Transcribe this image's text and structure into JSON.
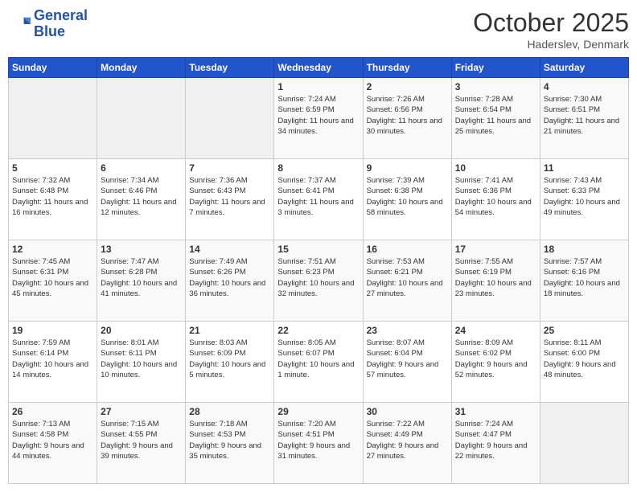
{
  "header": {
    "logo_line1": "General",
    "logo_line2": "Blue",
    "month_title": "October 2025",
    "location": "Haderslev, Denmark"
  },
  "days_of_week": [
    "Sunday",
    "Monday",
    "Tuesday",
    "Wednesday",
    "Thursday",
    "Friday",
    "Saturday"
  ],
  "weeks": [
    [
      {
        "day": "",
        "info": ""
      },
      {
        "day": "",
        "info": ""
      },
      {
        "day": "",
        "info": ""
      },
      {
        "day": "1",
        "info": "Sunrise: 7:24 AM\nSunset: 6:59 PM\nDaylight: 11 hours\nand 34 minutes."
      },
      {
        "day": "2",
        "info": "Sunrise: 7:26 AM\nSunset: 6:56 PM\nDaylight: 11 hours\nand 30 minutes."
      },
      {
        "day": "3",
        "info": "Sunrise: 7:28 AM\nSunset: 6:54 PM\nDaylight: 11 hours\nand 25 minutes."
      },
      {
        "day": "4",
        "info": "Sunrise: 7:30 AM\nSunset: 6:51 PM\nDaylight: 11 hours\nand 21 minutes."
      }
    ],
    [
      {
        "day": "5",
        "info": "Sunrise: 7:32 AM\nSunset: 6:48 PM\nDaylight: 11 hours\nand 16 minutes."
      },
      {
        "day": "6",
        "info": "Sunrise: 7:34 AM\nSunset: 6:46 PM\nDaylight: 11 hours\nand 12 minutes."
      },
      {
        "day": "7",
        "info": "Sunrise: 7:36 AM\nSunset: 6:43 PM\nDaylight: 11 hours\nand 7 minutes."
      },
      {
        "day": "8",
        "info": "Sunrise: 7:37 AM\nSunset: 6:41 PM\nDaylight: 11 hours\nand 3 minutes."
      },
      {
        "day": "9",
        "info": "Sunrise: 7:39 AM\nSunset: 6:38 PM\nDaylight: 10 hours\nand 58 minutes."
      },
      {
        "day": "10",
        "info": "Sunrise: 7:41 AM\nSunset: 6:36 PM\nDaylight: 10 hours\nand 54 minutes."
      },
      {
        "day": "11",
        "info": "Sunrise: 7:43 AM\nSunset: 6:33 PM\nDaylight: 10 hours\nand 49 minutes."
      }
    ],
    [
      {
        "day": "12",
        "info": "Sunrise: 7:45 AM\nSunset: 6:31 PM\nDaylight: 10 hours\nand 45 minutes."
      },
      {
        "day": "13",
        "info": "Sunrise: 7:47 AM\nSunset: 6:28 PM\nDaylight: 10 hours\nand 41 minutes."
      },
      {
        "day": "14",
        "info": "Sunrise: 7:49 AM\nSunset: 6:26 PM\nDaylight: 10 hours\nand 36 minutes."
      },
      {
        "day": "15",
        "info": "Sunrise: 7:51 AM\nSunset: 6:23 PM\nDaylight: 10 hours\nand 32 minutes."
      },
      {
        "day": "16",
        "info": "Sunrise: 7:53 AM\nSunset: 6:21 PM\nDaylight: 10 hours\nand 27 minutes."
      },
      {
        "day": "17",
        "info": "Sunrise: 7:55 AM\nSunset: 6:19 PM\nDaylight: 10 hours\nand 23 minutes."
      },
      {
        "day": "18",
        "info": "Sunrise: 7:57 AM\nSunset: 6:16 PM\nDaylight: 10 hours\nand 18 minutes."
      }
    ],
    [
      {
        "day": "19",
        "info": "Sunrise: 7:59 AM\nSunset: 6:14 PM\nDaylight: 10 hours\nand 14 minutes."
      },
      {
        "day": "20",
        "info": "Sunrise: 8:01 AM\nSunset: 6:11 PM\nDaylight: 10 hours\nand 10 minutes."
      },
      {
        "day": "21",
        "info": "Sunrise: 8:03 AM\nSunset: 6:09 PM\nDaylight: 10 hours\nand 5 minutes."
      },
      {
        "day": "22",
        "info": "Sunrise: 8:05 AM\nSunset: 6:07 PM\nDaylight: 10 hours\nand 1 minute."
      },
      {
        "day": "23",
        "info": "Sunrise: 8:07 AM\nSunset: 6:04 PM\nDaylight: 9 hours\nand 57 minutes."
      },
      {
        "day": "24",
        "info": "Sunrise: 8:09 AM\nSunset: 6:02 PM\nDaylight: 9 hours\nand 52 minutes."
      },
      {
        "day": "25",
        "info": "Sunrise: 8:11 AM\nSunset: 6:00 PM\nDaylight: 9 hours\nand 48 minutes."
      }
    ],
    [
      {
        "day": "26",
        "info": "Sunrise: 7:13 AM\nSunset: 4:58 PM\nDaylight: 9 hours\nand 44 minutes."
      },
      {
        "day": "27",
        "info": "Sunrise: 7:15 AM\nSunset: 4:55 PM\nDaylight: 9 hours\nand 39 minutes."
      },
      {
        "day": "28",
        "info": "Sunrise: 7:18 AM\nSunset: 4:53 PM\nDaylight: 9 hours\nand 35 minutes."
      },
      {
        "day": "29",
        "info": "Sunrise: 7:20 AM\nSunset: 4:51 PM\nDaylight: 9 hours\nand 31 minutes."
      },
      {
        "day": "30",
        "info": "Sunrise: 7:22 AM\nSunset: 4:49 PM\nDaylight: 9 hours\nand 27 minutes."
      },
      {
        "day": "31",
        "info": "Sunrise: 7:24 AM\nSunset: 4:47 PM\nDaylight: 9 hours\nand 22 minutes."
      },
      {
        "day": "",
        "info": ""
      }
    ]
  ]
}
